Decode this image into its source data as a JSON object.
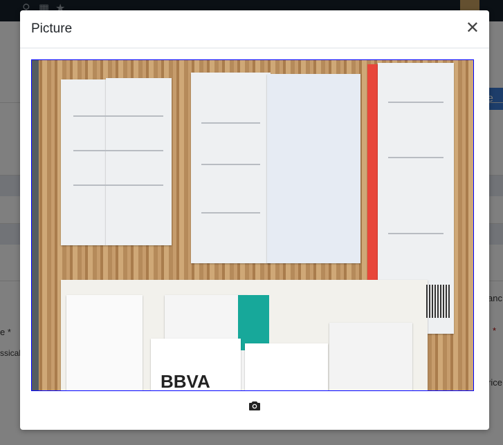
{
  "modal": {
    "title": "Picture",
    "close_icon": "close-icon",
    "image_alt": "Receipts on wooden table",
    "camera_icon": "camera-icon"
  },
  "background": {
    "button_fragment": "e",
    "right_fragments": [
      "anc",
      "*",
      "rice"
    ],
    "left_fragments": [
      "e *",
      "ssical"
    ]
  },
  "colors": {
    "image_border": "#0000ff",
    "accent": "#3a7bd5"
  }
}
